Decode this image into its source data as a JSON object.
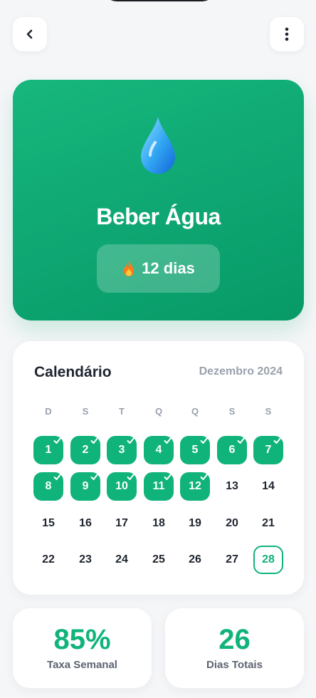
{
  "header": {
    "back_icon": "chevron-left-icon",
    "menu_icon": "more-vertical-icon"
  },
  "habit": {
    "title": "Beber Água",
    "icon": "water-drop-icon",
    "streak_icon": "fire-icon",
    "streak_text": "12 dias"
  },
  "calendar": {
    "title": "Calendário",
    "month": "Dezembro 2024",
    "weekdays": [
      "D",
      "S",
      "T",
      "Q",
      "Q",
      "S",
      "S"
    ],
    "weeks": [
      [
        "1",
        "2",
        "3",
        "4",
        "5",
        "6",
        "7"
      ],
      [
        "8",
        "9",
        "10",
        "11",
        "12",
        "13",
        "14"
      ],
      [
        "15",
        "16",
        "17",
        "18",
        "19",
        "20",
        "21"
      ],
      [
        "22",
        "23",
        "24",
        "25",
        "26",
        "27",
        "28"
      ]
    ],
    "completed_days": [
      1,
      2,
      3,
      4,
      5,
      6,
      7,
      8,
      9,
      10,
      11,
      12
    ],
    "today": 28
  },
  "stats": {
    "weekly_rate": {
      "value": "85%",
      "label": "Taxa Semanal"
    },
    "total_days": {
      "value": "26",
      "label": "Dias Totais"
    }
  },
  "colors": {
    "accent": "#10b37a",
    "background": "#f5f6f8"
  }
}
